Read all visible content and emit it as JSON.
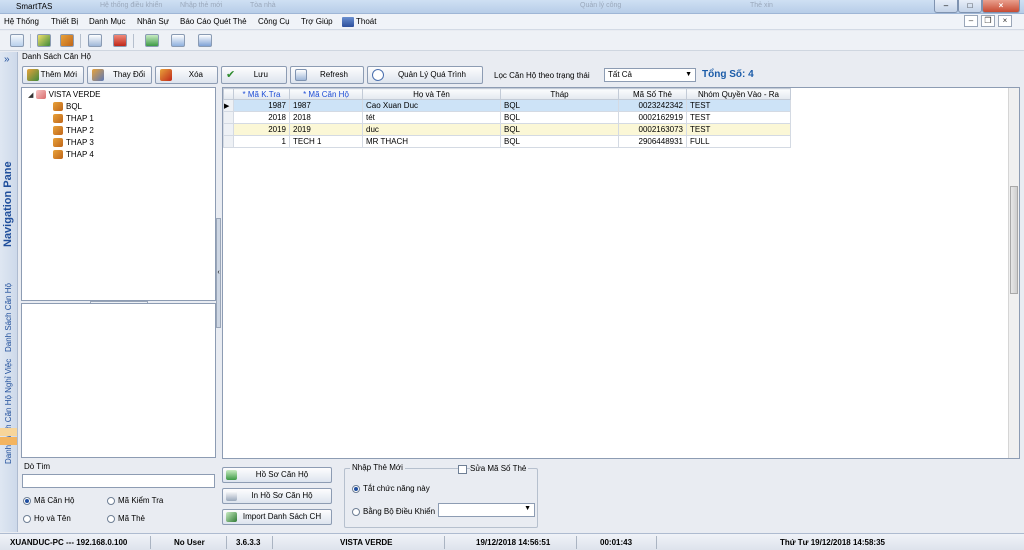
{
  "window": {
    "title": "SmartTAS",
    "bg_tab1": "Hệ thống điều khiển",
    "bg_tab2": "Nhập thẻ mới",
    "bg_tab3": "Tòa nhà",
    "bg_tab4": "Quản lý công",
    "bg_tab5": "Thẻ xin"
  },
  "menu": {
    "items": [
      "Hệ Thống",
      "Thiết Bị",
      "Danh Mục",
      "Nhân Sự",
      "Báo Cáo Quét Thẻ",
      "Công Cụ",
      "Trợ Giúp",
      "Thoát"
    ]
  },
  "nav": {
    "title": "Navigation Pane",
    "tab1": "Danh Sách Căn Hộ",
    "tab2": "Danh Sách Căn Hộ Nghỉ Việc",
    "collapse": "»"
  },
  "header": {
    "title": "Danh Sách Căn Hộ",
    "add": "Thêm Mới",
    "edit": "Thay Đổi",
    "delete": "Xóa",
    "save": "Lưu",
    "refresh": "Refresh",
    "process": "Quản Lý Quá Trình",
    "filter_label": "Lọc Căn Hộ theo trạng thái",
    "filter_value": "Tất Cả",
    "total": "Tổng Số: 4"
  },
  "tree": {
    "root": "VISTA VERDE",
    "children": [
      "BQL",
      "THAP 1",
      "THAP 2",
      "THAP 3",
      "THAP 4"
    ]
  },
  "grid": {
    "columns": [
      "* Mã K.Tra",
      "* Mã Căn Hộ",
      "Họ và Tên",
      "Tháp",
      "Mã Số Thẻ",
      "Nhóm Quyền Vào - Ra"
    ],
    "rows": [
      [
        "1987",
        "1987",
        "Cao Xuan Duc",
        "BQL",
        "0023242342",
        "TEST"
      ],
      [
        "2018",
        "2018",
        "tét",
        "BQL",
        "0002162919",
        "TEST"
      ],
      [
        "2019",
        "2019",
        "duc",
        "BQL",
        "0002163073",
        "TEST"
      ],
      [
        "1",
        "TECH 1",
        "MR THACH",
        "BQL",
        "2906448931",
        "FULL"
      ]
    ]
  },
  "search": {
    "title": "Dò Tìm",
    "opt1": "Mã Căn Hộ",
    "opt2": "Mã Kiểm Tra",
    "opt3": "Họ và Tên",
    "opt4": "Mã Thẻ"
  },
  "actions": {
    "profile": "Hồ Sơ Căn Hộ",
    "print": "In Hồ Sơ Căn Hộ",
    "import": "Import Danh Sách CH"
  },
  "newcard": {
    "title": "Nhập Thẻ Mới",
    "edit_card": "Sửa Mã Số Thẻ",
    "opt_off": "Tắt chức năng này",
    "opt_panel": "Bằng Bộ Điều Khiển"
  },
  "status": {
    "host": "XUANDUC-PC --- 192.168.0.100",
    "user": "No User",
    "version": "3.6.3.3",
    "site": "VISTA VERDE",
    "datetime": "19/12/2018 14:56:51",
    "elapsed": "00:01:43",
    "now": "Thứ Tư 19/12/2018 14:58:35"
  },
  "colors": {
    "accent": "#1f4ea0",
    "total": "#1a5ba8",
    "selected_row": "#cde3f7",
    "alt_row": "#fbf7d6"
  }
}
